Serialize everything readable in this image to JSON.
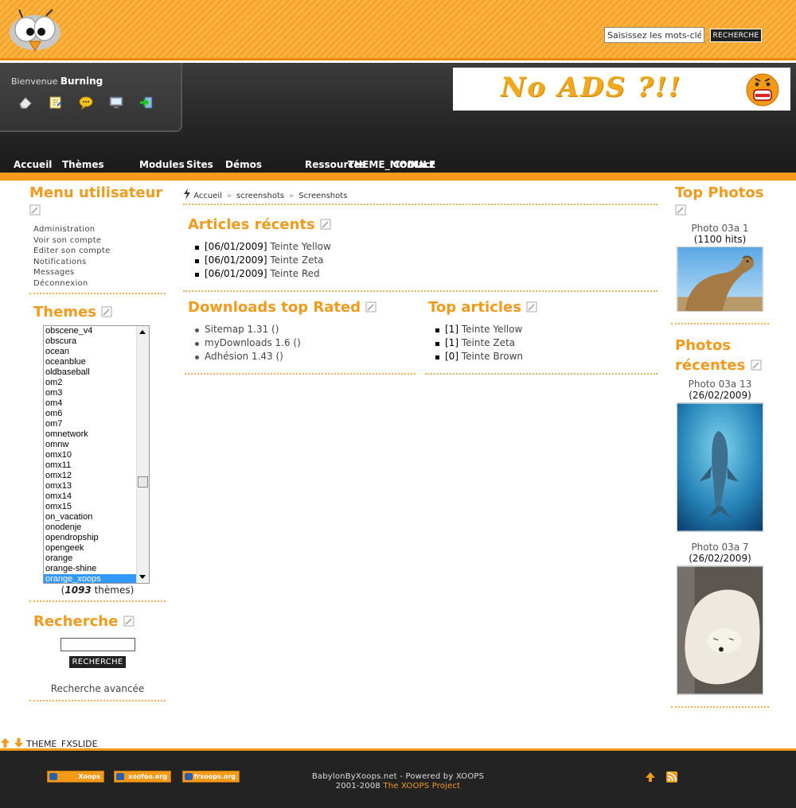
{
  "header": {
    "search_placeholder": "Saisissez les mots-clés",
    "search_button": "RECHERCHE"
  },
  "user": {
    "welcome_prefix": "Bienvenue",
    "username": "Burning"
  },
  "ad": {
    "text": "No ADS ?!!"
  },
  "nav": {
    "items": [
      "Accueil",
      "Thèmes",
      "Modules",
      "Sites",
      "Démos",
      "Ressources",
      "THEME_MODULE",
      "Contact"
    ]
  },
  "user_menu": {
    "title": "Menu utilisateur",
    "links": [
      "Administration",
      "Voir son compte",
      "Editer son compte",
      "Notifications",
      "Messages",
      "Déconnexion"
    ]
  },
  "themes": {
    "title": "Themes",
    "items": [
      "obscene_v4",
      "obscura",
      "ocean",
      "oceanblue",
      "oldbaseball",
      "om2",
      "om3",
      "om4",
      "om6",
      "om7",
      "omnetwork",
      "omnw",
      "omx10",
      "omx11",
      "omx12",
      "omx13",
      "omx14",
      "omx15",
      "on_vacation",
      "onodenje",
      "opendropship",
      "opengeek",
      "orange",
      "orange-shine",
      "orange_xoops"
    ],
    "selected": "orange_xoops",
    "count": "1093",
    "count_suffix": "thèmes"
  },
  "search_block": {
    "title": "Recherche",
    "button": "RECHERCHE",
    "advanced": "Recherche avancée"
  },
  "breadcrumb": [
    "Accueil",
    "screenshots",
    "Screenshots"
  ],
  "recent_articles": {
    "title": "Articles récents",
    "items": [
      {
        "date": "[06/01/2009]",
        "title": "Teinte Yellow"
      },
      {
        "date": "[06/01/2009]",
        "title": "Teinte Zeta"
      },
      {
        "date": "[06/01/2009]",
        "title": "Teinte Red"
      }
    ]
  },
  "downloads_top": {
    "title": "Downloads top Rated",
    "items": [
      "Sitemap 1.31 ()",
      "myDownloads 1.6 ()",
      "Adhésion 1.43 ()"
    ]
  },
  "top_articles": {
    "title": "Top articles",
    "items": [
      {
        "rank": "[1]",
        "title": "Teinte Yellow"
      },
      {
        "rank": "[1]",
        "title": "Teinte Zeta"
      },
      {
        "rank": "[0]",
        "title": "Teinte Brown"
      }
    ]
  },
  "top_photos": {
    "title": "Top Photos",
    "items": [
      {
        "caption": "Photo 03a 1",
        "meta": "(1100 hits)"
      }
    ]
  },
  "recent_photos": {
    "title_line1": "Photos",
    "title_line2": "récentes",
    "items": [
      {
        "caption": "Photo 03a 13",
        "meta": "(26/02/2009)"
      },
      {
        "caption": "Photo 03a 7",
        "meta": "(26/02/2009)"
      }
    ]
  },
  "fxslide": "THEME_FXSLIDE",
  "footer": {
    "badges": [
      "Xoops",
      "xoofoo.org",
      "frxoops.org"
    ],
    "line1": "BabylonByXoops.net - Powered by XOOPS",
    "line2_prefix": "2001-2008",
    "line2_link": "The XOOPS Project"
  },
  "colors": {
    "accent": "#f39a1a",
    "dark": "#232323"
  }
}
